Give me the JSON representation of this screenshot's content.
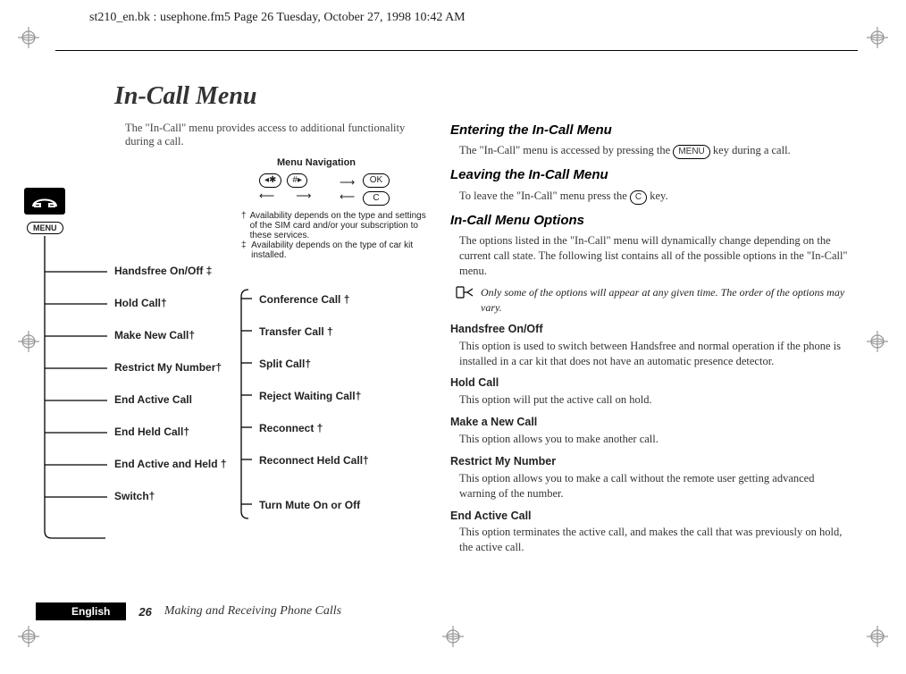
{
  "header": "st210_en.bk : usephone.fm5  Page 26  Tuesday, October 27, 1998  10:42 AM",
  "title": "In-Call Menu",
  "intro": "The \"In-Call\" menu provides access to additional functionality during a call.",
  "diagram": {
    "nav_title": "Menu Navigation",
    "key_star": "◂✱",
    "key_hash": "#▸",
    "key_ok": "OK",
    "key_c": "C",
    "fn_dagger": "Availability depends on the type and settings of the SIM card and/or your subscription to these services.",
    "fn_ddagger": "Availability depends on the type of car kit installed.",
    "menu_label": "MENU",
    "left_items": [
      "Handsfree On/Off ‡",
      "Hold Call†",
      "Make New Call†",
      "Restrict My Number†",
      "End Active Call",
      "End Held Call†",
      "End Active and Held †",
      "Switch†"
    ],
    "right_items": [
      "Conference Call †",
      "Transfer Call †",
      "Split Call†",
      "Reject Waiting Call†",
      "Reconnect †",
      "Reconnect Held Call†",
      "Turn Mute On or Off"
    ]
  },
  "right": {
    "s1_h": "Entering the In-Call Menu",
    "s1_p_a": "The \"In-Call\" menu is accessed by pressing the ",
    "s1_p_b": " key during a call.",
    "s2_h": "Leaving the In-Call Menu",
    "s2_p_a": "To leave the \"In-Call\" menu press the ",
    "s2_p_b": " key.",
    "s3_h": "In-Call Menu Options",
    "s3_p": "The options listed in the \"In-Call\" menu will dynamically change depending on the current call state. The following list contains all of the possible options in the \"In-Call\" menu.",
    "note": "Only some of the options will appear at any given time. The order of the options may vary.",
    "opt1_h": "Handsfree On/Off",
    "opt1_p": "This option is used to switch between Handsfree and normal operation if the phone is installed in a car kit that does not have an automatic presence detector.",
    "opt2_h": "Hold Call",
    "opt2_p": "This option will put the active call on hold.",
    "opt3_h": "Make a New Call",
    "opt3_p": "This option allows you to make another call.",
    "opt4_h": "Restrict My Number",
    "opt4_p": "This option allows you to make a call without the remote user getting advanced warning of the number.",
    "opt5_h": "End Active Call",
    "opt5_p": "This option terminates the active call, and makes the call that was previously on hold, the active call.",
    "menu_key": "MENU",
    "c_key": "C"
  },
  "footer": {
    "lang": "English",
    "page": "26",
    "title": "Making and Receiving Phone Calls"
  }
}
